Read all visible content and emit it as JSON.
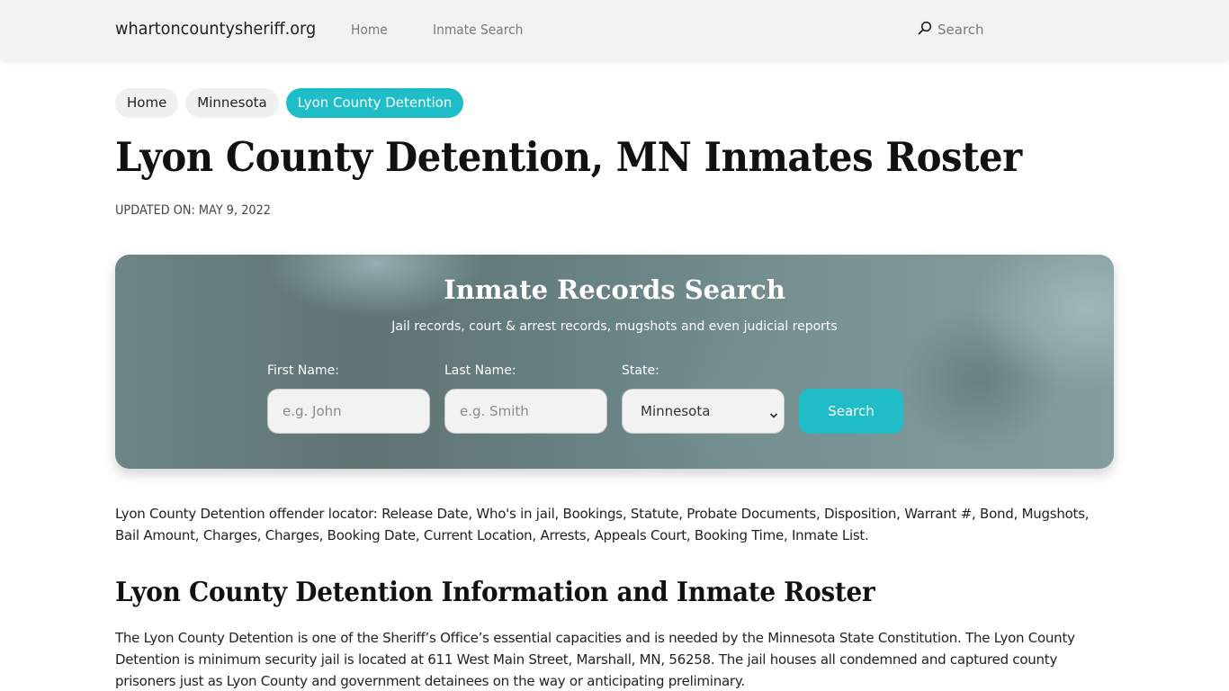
{
  "navbar": {
    "brand": "whartoncountysheriff.org",
    "links": [
      "Home",
      "Inmate Search"
    ],
    "search_label": "Search"
  },
  "breadcrumb": [
    "Home",
    "Minnesota",
    "Lyon County Detention"
  ],
  "page": {
    "title": "Lyon County Detention, MN Inmates Roster",
    "updated": "UPDATED ON: MAY 9, 2022"
  },
  "search_panel": {
    "title": "Inmate Records Search",
    "subtitle": "Jail records, court & arrest records, mugshots and even judicial reports",
    "first_name_label": "First Name:",
    "first_name_placeholder": "e.g. John",
    "last_name_label": "Last Name:",
    "last_name_placeholder": "e.g. Smith",
    "state_label": "State:",
    "state_selected": "Minnesota",
    "submit_label": "Search"
  },
  "content": {
    "intro": "Lyon County Detention offender locator: Release Date, Who's in jail, Bookings, Statute, Probate Documents, Disposition, Warrant #, Bond, Mugshots, Bail Amount, Charges, Charges, Booking Date, Current Location, Arrests, Appeals Court, Booking Time, Inmate List.",
    "section_title": "Lyon County Detention Information and Inmate Roster",
    "section_body": "The Lyon County Detention is one of the Sheriff’s Office’s essential capacities and is needed by the Minnesota State Constitution. The Lyon County Detention is minimum security jail is located at 611 West Main Street, Marshall, MN, 56258. The jail houses all condemned and captured county prisoners just as Lyon County and government detainees on the way or anticipating preliminary."
  },
  "colors": {
    "accent": "#1ebdc8",
    "navbar_bg": "#f2f2f2",
    "panel_bg": "#6c8586"
  }
}
